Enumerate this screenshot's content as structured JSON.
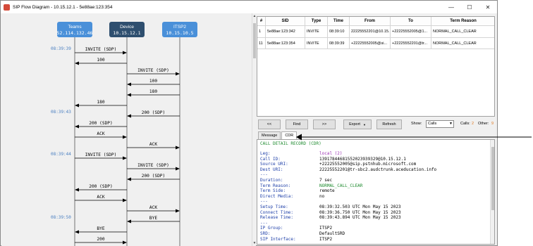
{
  "window": {
    "title": "SIP Flow Diagram - 10.15.12.1 - 5e88ae:123:354",
    "minimize_glyph": "—",
    "maximize_glyph": "☐",
    "close_glyph": "✕"
  },
  "flow": {
    "endpoints": [
      {
        "name": "Teams",
        "ip": "52.114.132.46",
        "color": "#4a90d9"
      },
      {
        "name": "Device",
        "ip": "10.15.12.1",
        "color": "#2f4f6f"
      },
      {
        "name": "ITSP2",
        "ip": "10.15.10.5",
        "color": "#4a90d9"
      }
    ],
    "timestamps": [
      {
        "text": "08:39:39",
        "row": 0
      },
      {
        "text": "08:39:43",
        "row": 6
      },
      {
        "text": "08:39:44",
        "row": 10
      },
      {
        "text": "08:39:50",
        "row": 16
      }
    ],
    "messages": [
      {
        "label": "INVITE (SDP)",
        "from": 0,
        "to": 1
      },
      {
        "label": "100",
        "from": 1,
        "to": 0
      },
      {
        "label": "INVITE (SDP)",
        "from": 1,
        "to": 2
      },
      {
        "label": "100",
        "from": 2,
        "to": 1
      },
      {
        "label": "180",
        "from": 2,
        "to": 1
      },
      {
        "label": "180",
        "from": 1,
        "to": 0
      },
      {
        "label": "200 (SDP)",
        "from": 2,
        "to": 1
      },
      {
        "label": "200 (SDP)",
        "from": 1,
        "to": 0
      },
      {
        "label": "ACK",
        "from": 0,
        "to": 1
      },
      {
        "label": "ACK",
        "from": 1,
        "to": 2
      },
      {
        "label": "INVITE (SDP)",
        "from": 0,
        "to": 1
      },
      {
        "label": "INVITE (SDP)",
        "from": 1,
        "to": 2
      },
      {
        "label": "200 (SDP)",
        "from": 2,
        "to": 1
      },
      {
        "label": "200 (SDP)",
        "from": 1,
        "to": 0
      },
      {
        "label": "ACK",
        "from": 0,
        "to": 1
      },
      {
        "label": "ACK",
        "from": 1,
        "to": 2
      },
      {
        "label": "BYE",
        "from": 2,
        "to": 1
      },
      {
        "label": "BYE",
        "from": 1,
        "to": 0
      },
      {
        "label": "200",
        "from": 0,
        "to": 1
      }
    ]
  },
  "calls": {
    "columns": [
      "#",
      "SID",
      "Type",
      "Time",
      "From",
      "To",
      "Term Reason"
    ],
    "rows": [
      [
        "1",
        "5e88ae:123:342",
        "INVITE",
        "08:39:10",
        "22225552201@10.15...",
        "+22225552005@1...",
        "NORMAL_CALL_CLEAR"
      ],
      [
        "11",
        "5e88ae:123:354",
        "INVITE",
        "08:39:39",
        "+22225552005@si...",
        "+22225552201@tr...",
        "NORMAL_CALL_CLEAR"
      ]
    ]
  },
  "toolbar": {
    "prev": "<<",
    "find": "Find",
    "next": ">>",
    "export": "Export",
    "refresh": "Refresh",
    "show_label": "Show:",
    "show_value": "Calls",
    "calls_label": "Calls:",
    "calls_count": "2",
    "other_label": "Other:",
    "other_count": "9"
  },
  "detail_tabs": {
    "message": "Message",
    "cdr": "CDR"
  },
  "cdr": {
    "heading": "CALL DETAIL RECORD (CDR)",
    "leg_key": "Leg:",
    "leg_val": "local (2)",
    "callid_key": "Call ID:",
    "callid_val": "13917844681552023939329@10.15.12.1",
    "source_key": "Source URI:",
    "source_val": "+22225552005@sip.pstnhub.microsoft.com",
    "dest_key": "Dest URI:",
    "dest_val": "22225552201@tr-sbc2.audctrunk.aceducation.info",
    "sep": "---",
    "duration_key": "Duration:",
    "duration_val": "7 sec",
    "reason_key": "Term Reason:",
    "reason_val": "NORMAL_CALL_CLEAR",
    "side_key": "Term Side:",
    "side_val": "remote",
    "media_key": "Direct Media:",
    "media_val": "no",
    "setup_key": "Setup Time:",
    "setup_val": "08:39:32.503  UTC Mon May 15 2023",
    "connect_key": "Connect Time:",
    "connect_val": "08:39:36.750  UTC Mon May 15 2023",
    "release_key": "Release Time:",
    "release_val": "08:39:43.894  UTC Mon May 15 2023",
    "ipgroup_key": "IP Group:",
    "ipgroup_val": "ITSP2",
    "srd_key": "SRD:",
    "srd_val": "DefaultSRD",
    "sipif_key": "SIP Interface:",
    "sipif_val": "ITSP2"
  }
}
